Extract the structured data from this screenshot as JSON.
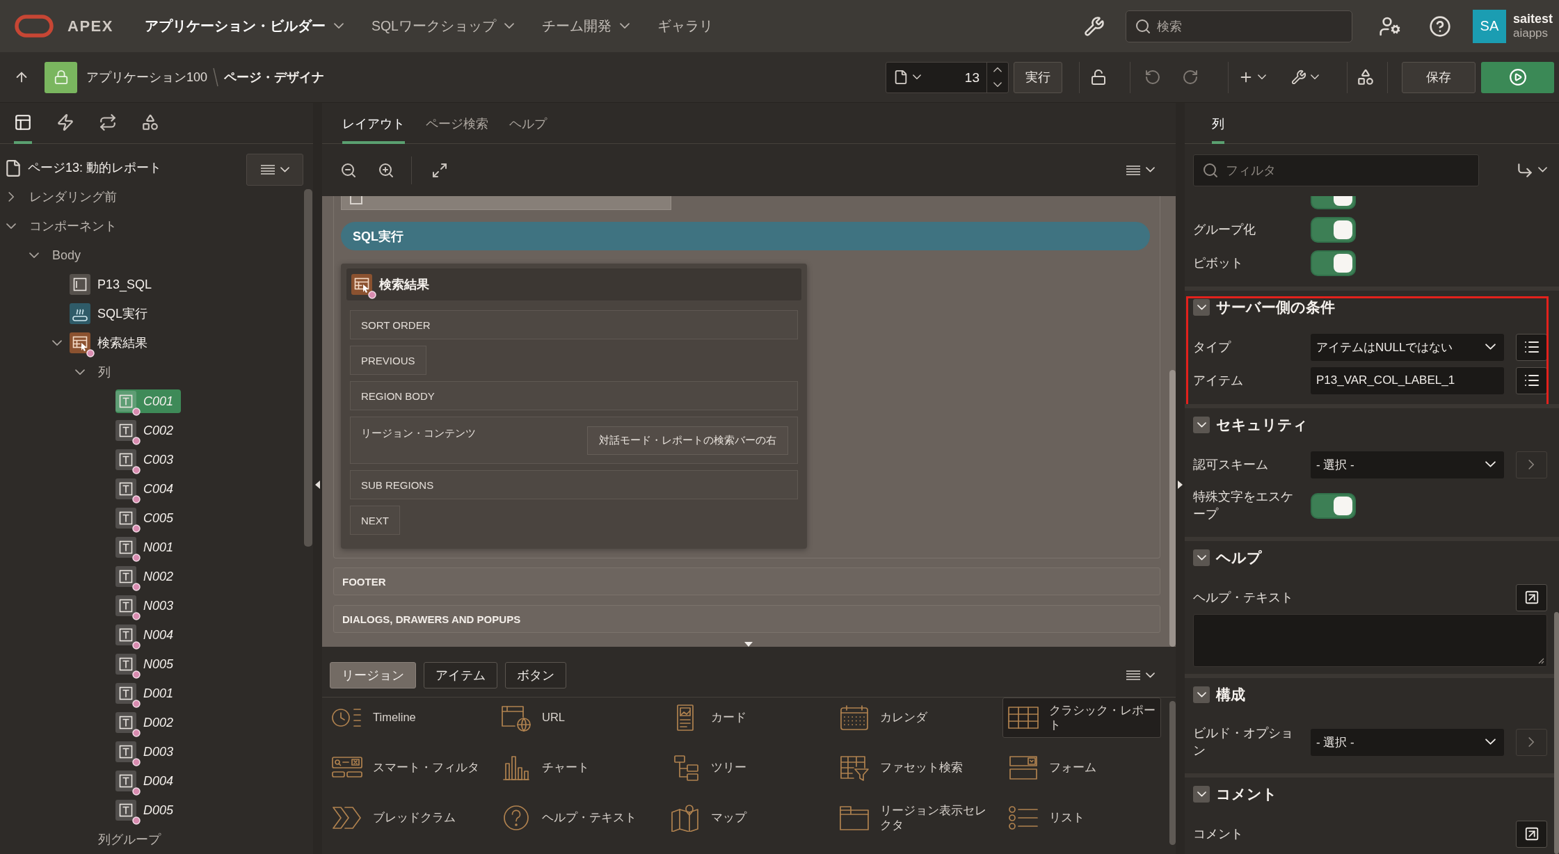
{
  "header": {
    "logo_text": "APEX",
    "nav": [
      {
        "label": "アプリケーション・ビルダー",
        "selected": true,
        "has_menu": true
      },
      {
        "label": "SQLワークショップ",
        "selected": false,
        "has_menu": true
      },
      {
        "label": "チーム開発",
        "selected": false,
        "has_menu": true
      },
      {
        "label": "ギャラリ",
        "selected": false,
        "has_menu": false
      }
    ],
    "search": {
      "placeholder": "検索"
    },
    "user": {
      "initials": "SA",
      "name": "saitest",
      "workspace": "aiapps"
    }
  },
  "toolbar": {
    "breadcrumb": [
      {
        "label": "アプリケーション100",
        "current": false
      },
      {
        "label": "ページ・デザイナ",
        "current": true
      }
    ],
    "page_number": "13",
    "execute": "実行",
    "undo": {
      "disabled": true
    },
    "redo": {
      "disabled": true
    },
    "save": "保存"
  },
  "left_panel": {
    "tabs": [
      {
        "kind": "rendering",
        "selected": true
      },
      {
        "kind": "dynamic_actions",
        "selected": false
      },
      {
        "kind": "processing",
        "selected": false
      },
      {
        "kind": "shared",
        "selected": false
      }
    ],
    "page_title": "ページ13: 動的レポート",
    "tree": [
      {
        "label": "レンダリング前",
        "kind": "folder",
        "expanded": false,
        "selected": false
      },
      {
        "label": "コンポーネント",
        "kind": "folder",
        "expanded": true,
        "selected": false,
        "children": [
          {
            "label": "Body",
            "kind": "folder",
            "expanded": true,
            "selected": false,
            "children": [
              {
                "label": "P13_SQL",
                "kind": "item",
                "selected": false,
                "conditional": false
              },
              {
                "label": "SQL実行",
                "kind": "button",
                "selected": false,
                "conditional": false
              },
              {
                "label": "検索結果",
                "kind": "report",
                "expanded": true,
                "selected": false,
                "conditional": true,
                "children": [
                  {
                    "label": "列",
                    "kind": "folder",
                    "expanded": true,
                    "selected": false,
                    "children": [
                      {
                        "label": "C001",
                        "kind": "column",
                        "selected": true,
                        "conditional": true
                      },
                      {
                        "label": "C002",
                        "kind": "column",
                        "selected": false,
                        "conditional": true
                      },
                      {
                        "label": "C003",
                        "kind": "column",
                        "selected": false,
                        "conditional": true
                      },
                      {
                        "label": "C004",
                        "kind": "column",
                        "selected": false,
                        "conditional": true
                      },
                      {
                        "label": "C005",
                        "kind": "column",
                        "selected": false,
                        "conditional": true
                      },
                      {
                        "label": "N001",
                        "kind": "column",
                        "selected": false,
                        "conditional": true
                      },
                      {
                        "label": "N002",
                        "kind": "column",
                        "selected": false,
                        "conditional": true
                      },
                      {
                        "label": "N003",
                        "kind": "column",
                        "selected": false,
                        "conditional": true
                      },
                      {
                        "label": "N004",
                        "kind": "column",
                        "selected": false,
                        "conditional": true
                      },
                      {
                        "label": "N005",
                        "kind": "column",
                        "selected": false,
                        "conditional": true
                      },
                      {
                        "label": "D001",
                        "kind": "column",
                        "selected": false,
                        "conditional": true
                      },
                      {
                        "label": "D002",
                        "kind": "column",
                        "selected": false,
                        "conditional": true
                      },
                      {
                        "label": "D003",
                        "kind": "column",
                        "selected": false,
                        "conditional": true
                      },
                      {
                        "label": "D004",
                        "kind": "column",
                        "selected": false,
                        "conditional": true
                      },
                      {
                        "label": "D005",
                        "kind": "column",
                        "selected": false,
                        "conditional": true
                      }
                    ]
                  },
                  {
                    "label": "列グループ",
                    "kind": "folder",
                    "selected": false
                  }
                ]
              }
            ]
          }
        ]
      }
    ]
  },
  "layout_tabs": [
    {
      "label": "レイアウト",
      "selected": true
    },
    {
      "label": "ページ検索",
      "selected": false
    },
    {
      "label": "ヘルプ",
      "selected": false
    }
  ],
  "canvas": {
    "button": "SQL実行",
    "region": {
      "title": "検索結果",
      "conditional": true,
      "slots": [
        {
          "label": "SORT ORDER",
          "kind": "wide"
        },
        {
          "label": "PREVIOUS",
          "kind": "narrow"
        },
        {
          "label": "REGION BODY",
          "kind": "wide"
        },
        {
          "label": "リージョン・コンテンツ",
          "kind": "content",
          "component": "対話モード・レポートの検索バーの右"
        },
        {
          "label": "SUB REGIONS",
          "kind": "wide"
        },
        {
          "label": "NEXT",
          "kind": "narrow"
        }
      ]
    },
    "page_slots": [
      {
        "label": "FOOTER"
      },
      {
        "label": "DIALOGS, DRAWERS AND POPUPS"
      }
    ]
  },
  "gallery": {
    "tabs": [
      {
        "label": "リージョン",
        "selected": true
      },
      {
        "label": "アイテム",
        "selected": false
      },
      {
        "label": "ボタン",
        "selected": false
      }
    ],
    "items": [
      {
        "label": "Timeline",
        "kind": "timeline",
        "selected": false
      },
      {
        "label": "URL",
        "kind": "url",
        "selected": false
      },
      {
        "label": "カード",
        "kind": "cards",
        "selected": false
      },
      {
        "label": "カレンダ",
        "kind": "calendar",
        "selected": false
      },
      {
        "label": "クラシック・レポート",
        "kind": "classic_report",
        "selected": true
      },
      {
        "label": "スマート・フィルタ",
        "kind": "smart_filter",
        "selected": false
      },
      {
        "label": "チャート",
        "kind": "chart",
        "selected": false
      },
      {
        "label": "ツリー",
        "kind": "tree",
        "selected": false
      },
      {
        "label": "ファセット検索",
        "kind": "faceted_search",
        "selected": false
      },
      {
        "label": "フォーム",
        "kind": "form",
        "selected": false
      },
      {
        "label": "ブレッドクラム",
        "kind": "breadcrumb",
        "selected": false
      },
      {
        "label": "ヘルプ・テキスト",
        "kind": "help_text",
        "selected": false
      },
      {
        "label": "マップ",
        "kind": "map",
        "selected": false
      },
      {
        "label": "リージョン表示セレクタ",
        "kind": "region_selector",
        "selected": false
      },
      {
        "label": "リスト",
        "kind": "list",
        "selected": false
      }
    ]
  },
  "properties": {
    "tabs": [
      {
        "label": "列",
        "selected": true
      }
    ],
    "filter": {
      "placeholder": "フィルタ"
    },
    "groups": [
      {
        "rows": [
          {
            "kind": "toggle",
            "on": true
          },
          {
            "label": "グループ化",
            "kind": "toggle",
            "on": true
          },
          {
            "label": "ピボット",
            "kind": "toggle",
            "on": true
          }
        ]
      },
      {
        "title": "サーバー側の条件",
        "expanded": true,
        "highlighted": true,
        "rows": [
          {
            "label": "タイプ",
            "kind": "select",
            "value": "アイテムはNULLではない",
            "button": {
              "kind": "list"
            }
          },
          {
            "label": "アイテム",
            "kind": "text",
            "value": "P13_VAR_COL_LABEL_1",
            "button": {
              "kind": "list"
            }
          }
        ]
      },
      {
        "title": "セキュリティ",
        "expanded": true,
        "highlighted": false,
        "rows": [
          {
            "label": "認可スキーム",
            "kind": "select",
            "value": "- 選択 -",
            "button": {
              "kind": "link"
            }
          },
          {
            "label": "特殊文字をエスケープ",
            "kind": "toggle",
            "on": true
          }
        ]
      },
      {
        "title": "ヘルプ",
        "expanded": true,
        "highlighted": false,
        "rows": [
          {
            "label": "ヘルプ・テキスト",
            "kind": "textarea",
            "button": {
              "kind": "expand"
            }
          }
        ]
      },
      {
        "title": "構成",
        "expanded": true,
        "highlighted": false,
        "rows": [
          {
            "label": "ビルド・オプション",
            "kind": "select",
            "value": "- 選択 -",
            "button": {
              "kind": "link"
            }
          }
        ]
      },
      {
        "title": "コメント",
        "expanded": true,
        "highlighted": false,
        "rows": [
          {
            "label": "コメント",
            "kind": "label",
            "button": {
              "kind": "expand"
            }
          }
        ]
      }
    ]
  }
}
